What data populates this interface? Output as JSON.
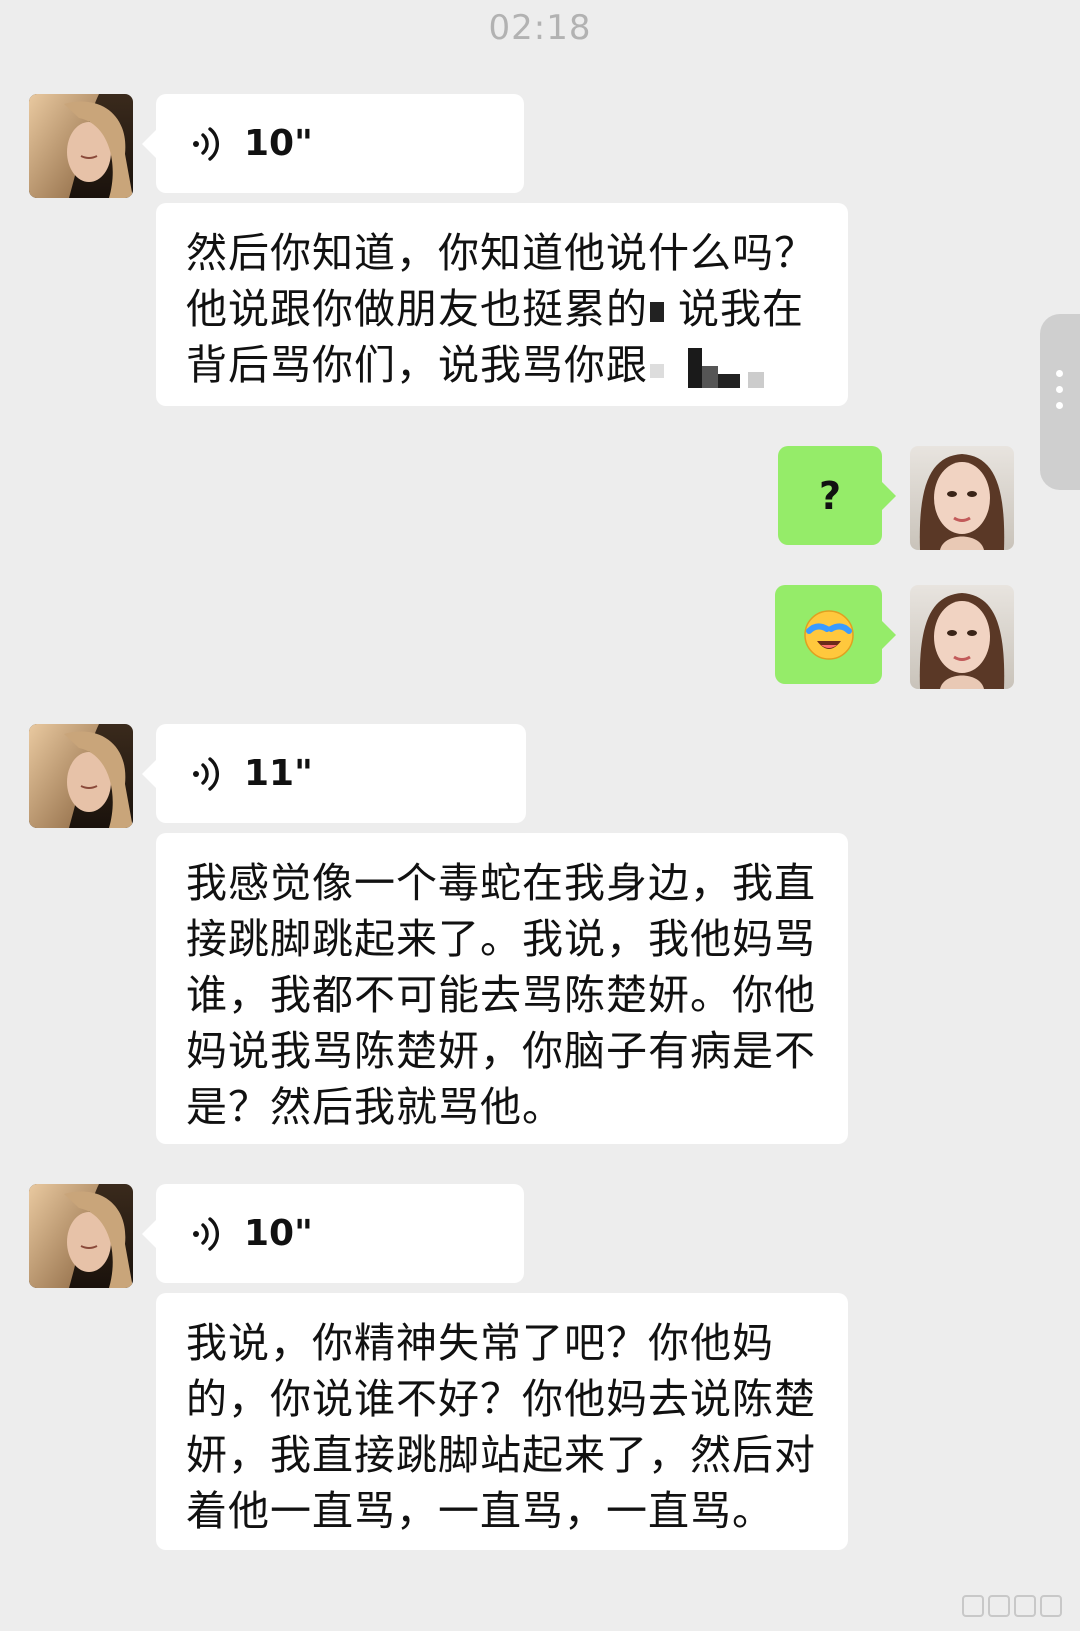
{
  "timestamp": "02:18",
  "messages": [
    {
      "from": "contact",
      "type": "voice",
      "duration": "10\""
    },
    {
      "from": "contact",
      "type": "text",
      "lines": [
        "然后你知道，你知道他说什么吗？",
        "他说跟你做朋友也挺累的",
        "说我在",
        "背后骂你们，说我骂你跟"
      ]
    },
    {
      "from": "me",
      "type": "text",
      "text": "?"
    },
    {
      "from": "me",
      "type": "emoji",
      "emoji": "😭"
    },
    {
      "from": "contact",
      "type": "voice",
      "duration": "11\""
    },
    {
      "from": "contact",
      "type": "text",
      "lines": [
        "我感觉像一个毒蛇在我身边，我直",
        "接跳脚跳起来了。我说，我他妈骂",
        "谁，我都不可能去骂陈楚妍。你他",
        "妈说我骂陈楚妍，你脑子有病是不",
        "是？然后我就骂他。"
      ]
    },
    {
      "from": "contact",
      "type": "voice",
      "duration": "10\""
    },
    {
      "from": "contact",
      "type": "text",
      "lines": [
        "我说，你精神失常了吧？你他妈",
        "的，你说谁不好？你他妈去说陈楚",
        "妍，我直接跳脚站起来了，然后对",
        "着他一直骂，一直骂，一直骂。"
      ]
    }
  ],
  "icons": {
    "voice": "voice-wave-icon",
    "menu": "more-dots-icon",
    "contact_avatar": "contact-avatar",
    "my_avatar": "my-avatar"
  },
  "colors": {
    "background": "#ededed",
    "bubble_left": "#ffffff",
    "bubble_right": "#95ec69",
    "timestamp": "#b2b2b2"
  }
}
